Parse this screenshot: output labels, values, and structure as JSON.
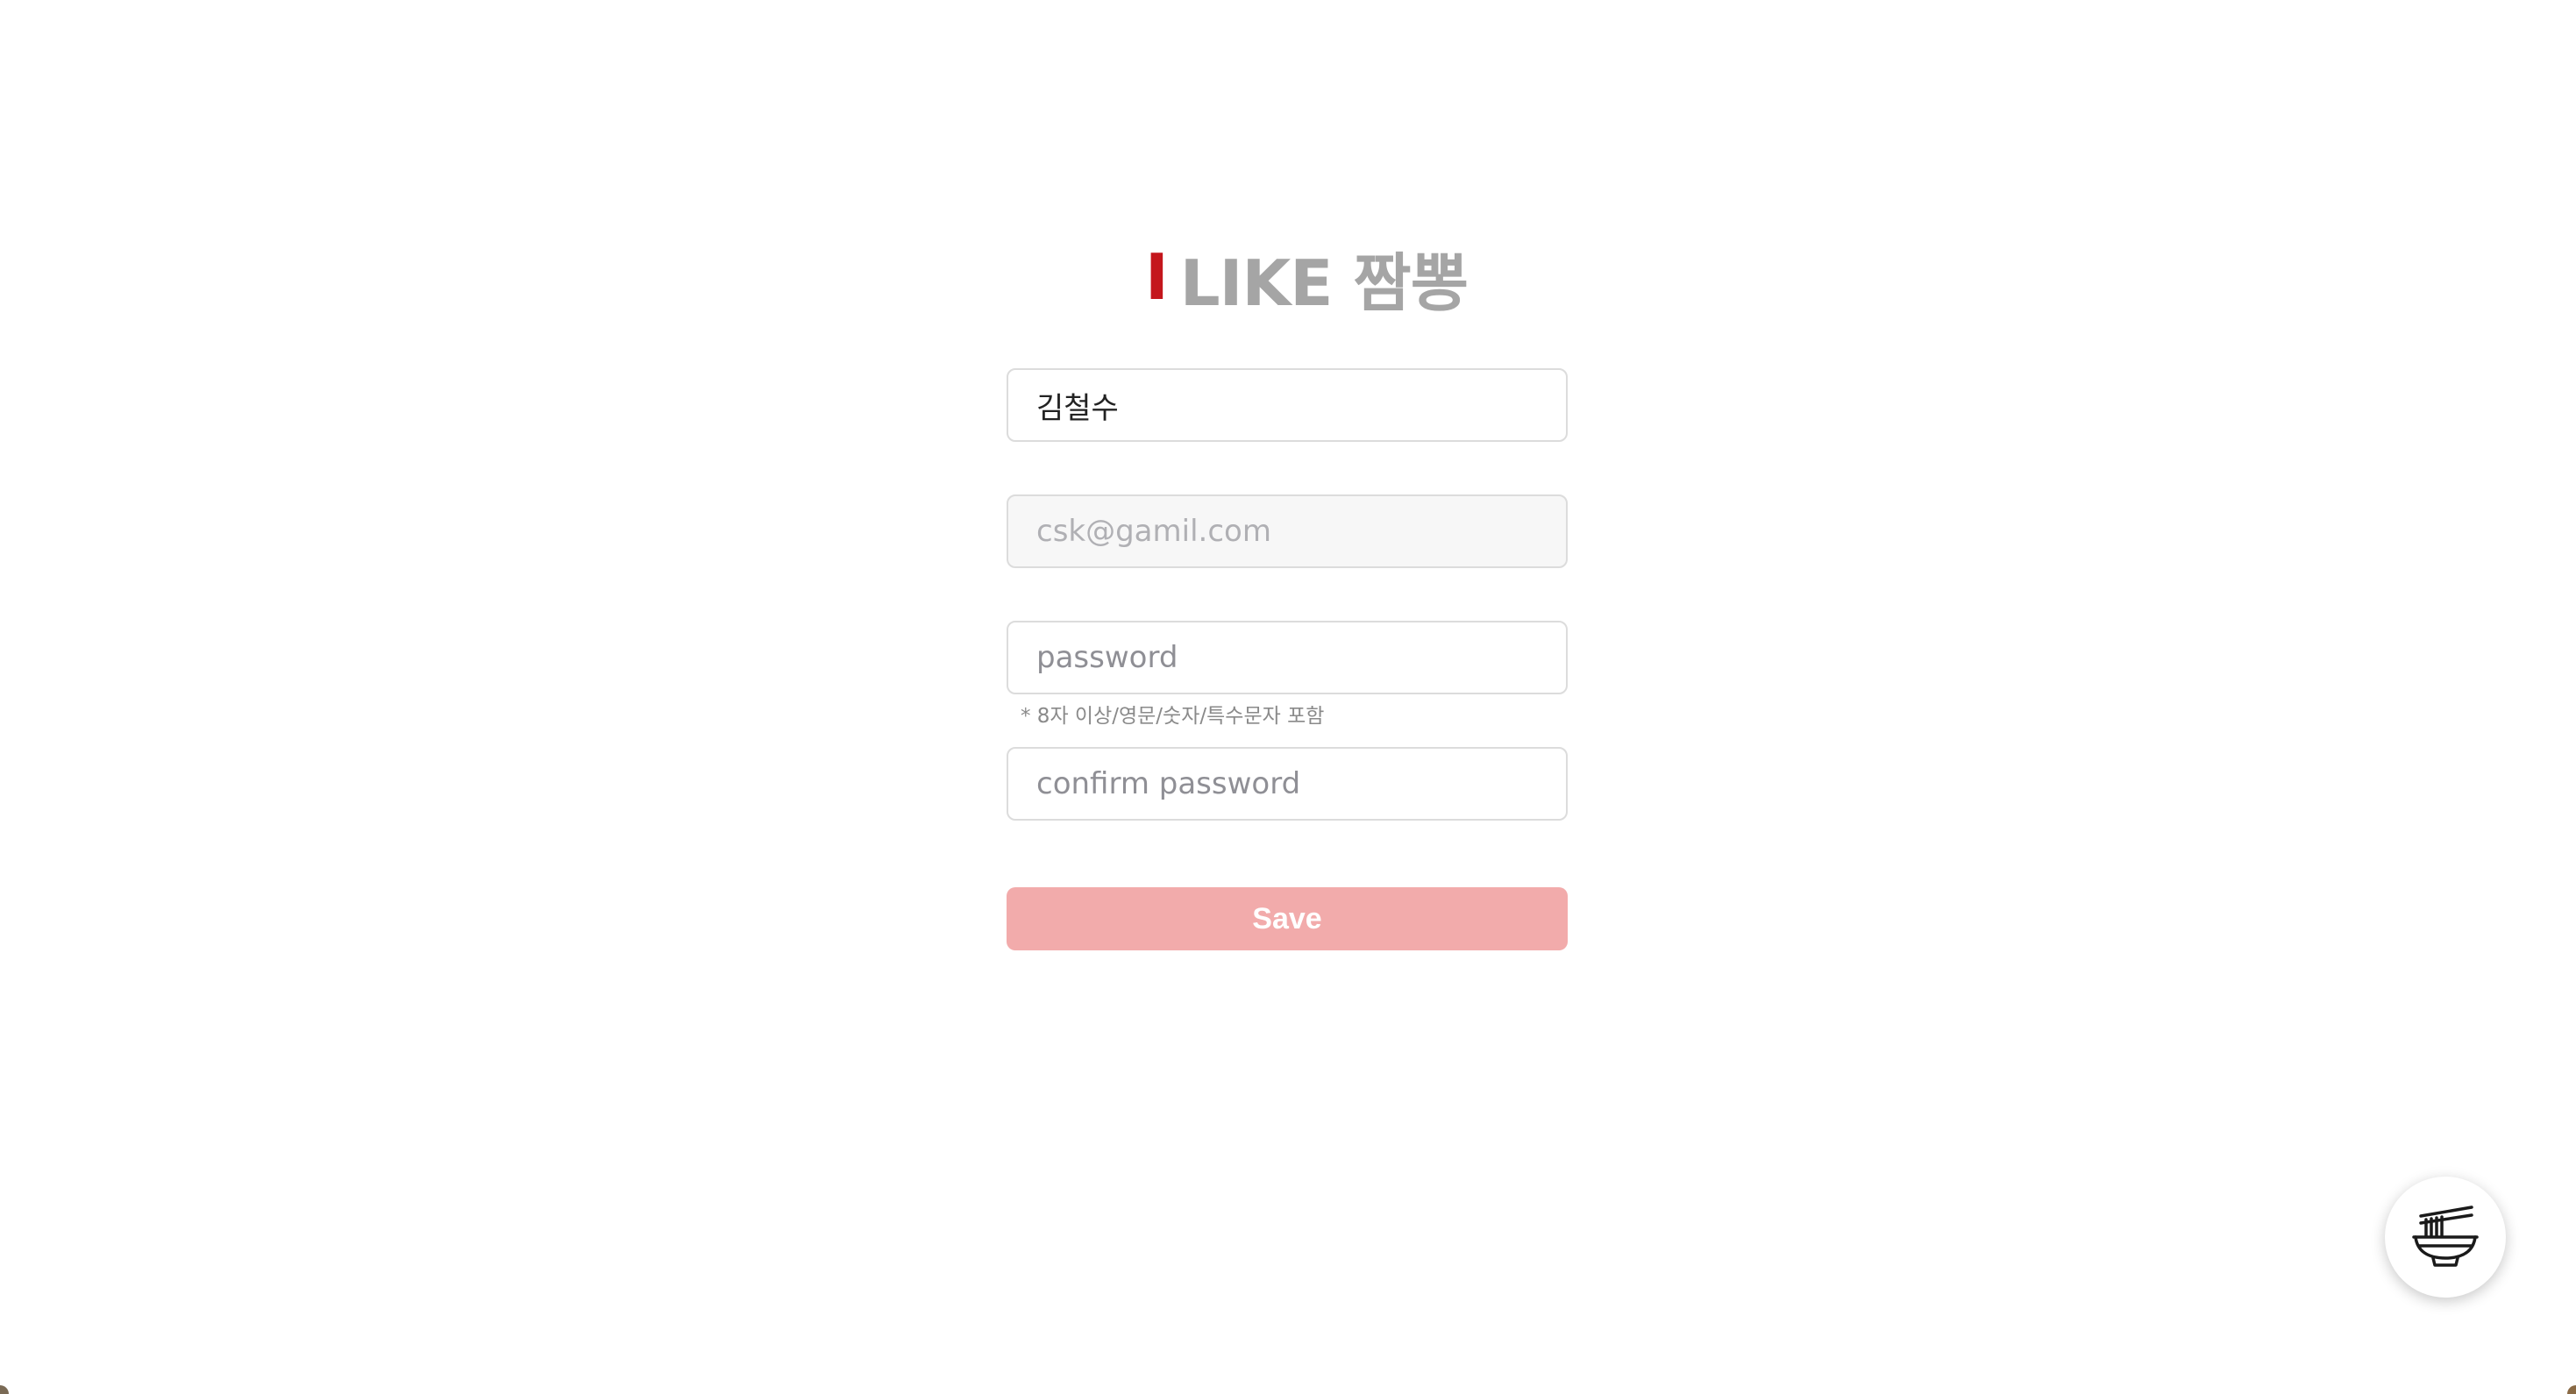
{
  "logo": {
    "accent": "I",
    "rest": "LIKE 짬뽕",
    "accent_color": "#c4161c",
    "text_color": "#a5a5a5"
  },
  "form": {
    "name": {
      "value": "김철수",
      "placeholder": ""
    },
    "email": {
      "value": "",
      "placeholder": "csk@gamil.com",
      "disabled": true
    },
    "password": {
      "value": "",
      "placeholder": "password"
    },
    "password_hint": "* 8자 이상/영문/숫자/특수문자 포함",
    "confirm_password": {
      "value": "",
      "placeholder": "confirm password"
    },
    "save_label": "Save",
    "save_color": "#f2abab"
  },
  "fab": {
    "icon": "noodle-bowl-icon"
  }
}
